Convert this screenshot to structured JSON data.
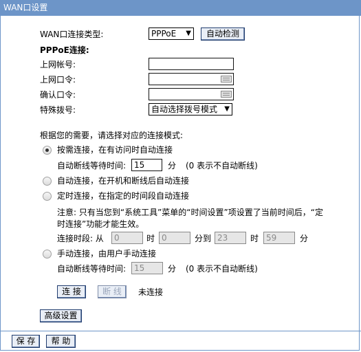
{
  "window": {
    "title": "WAN口设置"
  },
  "conn_type": {
    "label": "WAN口连接类型:",
    "selected": "PPPoE",
    "detect_button": "自动检测"
  },
  "pppoe": {
    "section_title": "PPPoE连接:",
    "account_label": "上网帐号:",
    "account_value": "",
    "password_label": "上网口令:",
    "confirm_label": "确认口令:",
    "dial_label": "特殊拨号:",
    "dial_selected": "自动选择拨号模式"
  },
  "mode": {
    "prompt": "根据您的需要，请选择对应的连接模式:",
    "on_demand": {
      "label": "按需连接，在有访问时自动连接",
      "checked": true,
      "wait_label": "自动断线等待时间:",
      "wait_value": "15",
      "unit": "分",
      "note": "(0 表示不自动断线)"
    },
    "auto": {
      "label": "自动连接，在开机和断线后自动连接",
      "checked": false
    },
    "timed": {
      "label": "定时连接，在指定的时间段自动连接",
      "checked": false,
      "note_line1": "注意: 只有当您到“系统工具”菜单的“时间设置”项设置了当前时间后，“定",
      "note_line2": "时连接”功能才能生效。",
      "period_label": "连接时段: 从",
      "from_hour": "0",
      "hour_unit1": "时",
      "from_min": "0",
      "to_label": "分到",
      "to_hour": "23",
      "hour_unit2": "时",
      "to_min": "59",
      "min_unit": "分"
    },
    "manual": {
      "label": "手动连接，由用户手动连接",
      "checked": false,
      "wait_label": "自动断线等待时间:",
      "wait_value": "15",
      "unit": "分",
      "note": "(0 表示不自动断线)"
    }
  },
  "actions": {
    "connect": "连 接",
    "disconnect": "断 线",
    "status": "未连接"
  },
  "advanced_button": "高级设置",
  "footer": {
    "save": "保 存",
    "help": "帮 助"
  }
}
